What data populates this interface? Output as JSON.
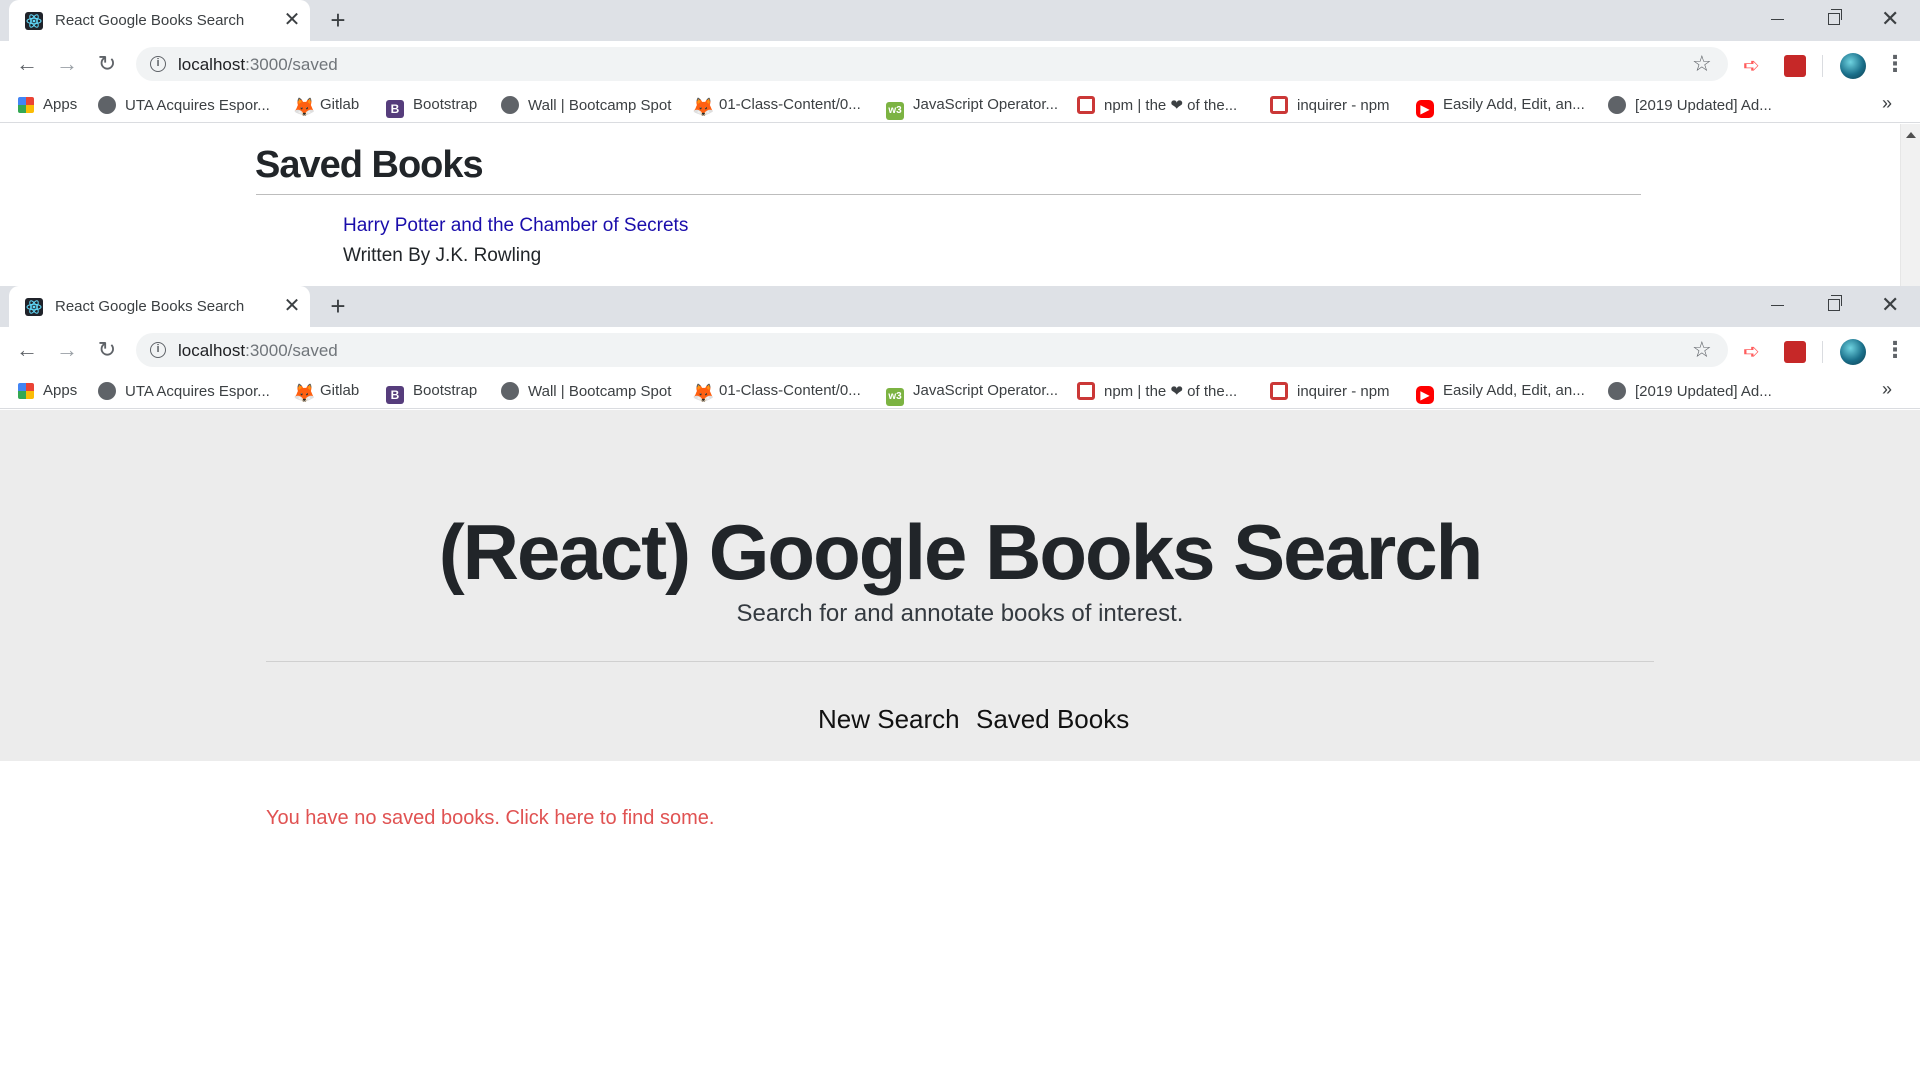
{
  "browser": {
    "tab_title": "React Google Books Search",
    "tab_close": "✕",
    "new_tab": "+",
    "url_host": "localhost",
    "url_path": ":3000/saved",
    "bookmarks": [
      {
        "label": "Apps",
        "icon": "apps-grid-icon"
      },
      {
        "label": "UTA Acquires Espor...",
        "icon": "globe-icon"
      },
      {
        "label": "Gitlab",
        "icon": "gitlab-icon"
      },
      {
        "label": "Bootstrap",
        "icon": "bootstrap-icon"
      },
      {
        "label": "Wall | Bootcamp Spot",
        "icon": "globe-icon"
      },
      {
        "label": "01-Class-Content/0...",
        "icon": "gitlab-icon"
      },
      {
        "label": "JavaScript Operator...",
        "icon": "w3-icon"
      },
      {
        "label": "npm | the ❤ of the...",
        "icon": "npm-icon"
      },
      {
        "label": "inquirer - npm",
        "icon": "npm-icon"
      },
      {
        "label": "Easily Add, Edit, an...",
        "icon": "youtube-icon"
      },
      {
        "label": "[2019 Updated] Ad...",
        "icon": "globe-icon"
      }
    ],
    "bookmarks_more": "»"
  },
  "top_page": {
    "heading": "Saved Books",
    "book": {
      "title": "Harry Potter and the Chamber of Secrets",
      "author": "Written By J.K. Rowling"
    }
  },
  "bottom_page": {
    "jumbotron": {
      "title": "(React) Google Books Search",
      "subtitle": "Search for and annotate books of interest."
    },
    "nav": {
      "new_search": "New Search",
      "saved_books": "Saved Books"
    },
    "empty_message": "You have no saved books. Click here to find some."
  },
  "colors": {
    "link": "#1a0dab",
    "empty_message": "#e05252",
    "jumbotron_bg": "#ececec"
  }
}
